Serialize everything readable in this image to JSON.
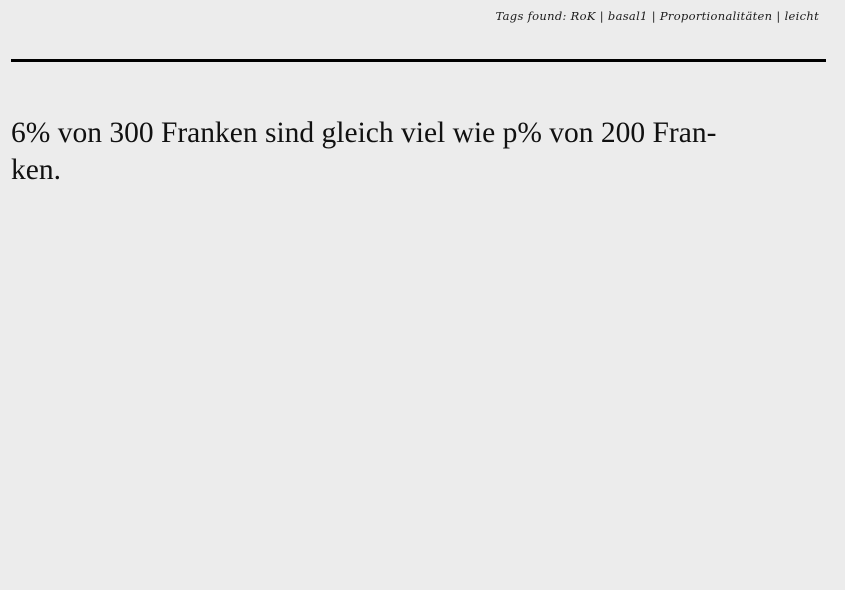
{
  "header": {
    "tags_prefix": "Tags found:",
    "tags": [
      "RoK",
      "basal1",
      "Proportionalitäten",
      "leicht"
    ],
    "separator": "|"
  },
  "problem": {
    "lines": [
      "6% von 300 Franken sind gleich viel wie p% von 200 Fran-",
      "ken."
    ]
  },
  "colors": {
    "background": "#ececec",
    "text": "#111111",
    "rule": "#000000"
  }
}
